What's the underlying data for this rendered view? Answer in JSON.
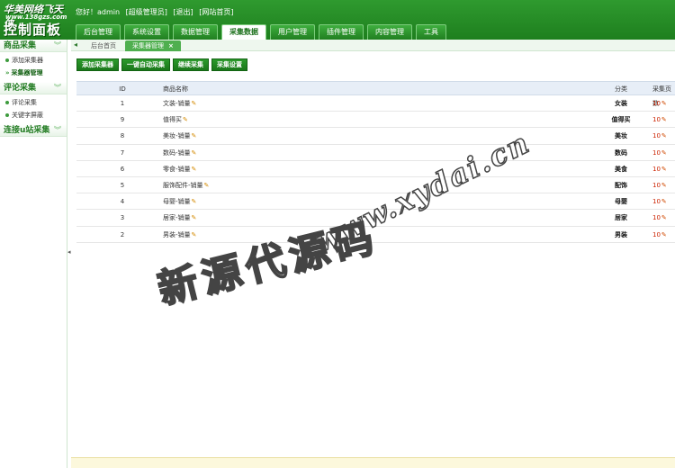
{
  "header": {
    "logo_top": "华美网络飞天侠",
    "logo_url": "www.138gzs.com",
    "logo_main": "控制面板",
    "greeting": "您好！admin",
    "role": "[超级管理员]",
    "logout": "[退出]",
    "site_home": "[网站首页]",
    "nav": [
      {
        "label": "后台管理"
      },
      {
        "label": "系统设置"
      },
      {
        "label": "数据管理"
      },
      {
        "label": "采集数据"
      },
      {
        "label": "用户管理"
      },
      {
        "label": "插件管理"
      },
      {
        "label": "内容管理"
      },
      {
        "label": "工具"
      }
    ],
    "active_nav": "采集数据"
  },
  "sidebar": {
    "groups": [
      {
        "title": "商品采集",
        "items": [
          {
            "label": "添加采集器"
          },
          {
            "label": "采集器管理"
          }
        ]
      },
      {
        "title": "评论采集",
        "items": [
          {
            "label": "评论采集"
          },
          {
            "label": "关键字屏蔽"
          }
        ]
      },
      {
        "title": "连接u站采集",
        "items": []
      }
    ],
    "chevron": "︾",
    "collapse": "◂"
  },
  "tabs": {
    "arrow": "◂",
    "items": [
      {
        "label": "后台首页"
      },
      {
        "label": "采集器管理"
      }
    ],
    "close": "×"
  },
  "actions": [
    {
      "label": "添加采集器"
    },
    {
      "label": "一键自动采集"
    },
    {
      "label": "继续采集"
    },
    {
      "label": "采集设置"
    }
  ],
  "table": {
    "headers": {
      "id": "ID",
      "name": "商品名称",
      "category": "分类",
      "required": "采集页数"
    },
    "rows": [
      {
        "id": "1",
        "name": "文装-销量",
        "category": "女装",
        "required": "10"
      },
      {
        "id": "9",
        "name": "值得买",
        "category": "值得买",
        "required": "10"
      },
      {
        "id": "8",
        "name": "美妆-销量",
        "category": "美妆",
        "required": "10"
      },
      {
        "id": "7",
        "name": "数码-销量",
        "category": "数码",
        "required": "10"
      },
      {
        "id": "6",
        "name": "零食-销量",
        "category": "美食",
        "required": "10"
      },
      {
        "id": "5",
        "name": "服饰配件-销量",
        "category": "配饰",
        "required": "10"
      },
      {
        "id": "4",
        "name": "母婴-销量",
        "category": "母婴",
        "required": "10"
      },
      {
        "id": "3",
        "name": "居家-销量",
        "category": "居家",
        "required": "10"
      },
      {
        "id": "2",
        "name": "男装-销量",
        "category": "男装",
        "required": "10"
      }
    ]
  },
  "watermark": {
    "url": "www.xydai.cn",
    "cn": "新源代源码"
  },
  "colors": {
    "brand_green": "#1e7f1e",
    "header_blue": "#e7eef7",
    "required_red": "#cc2200"
  }
}
